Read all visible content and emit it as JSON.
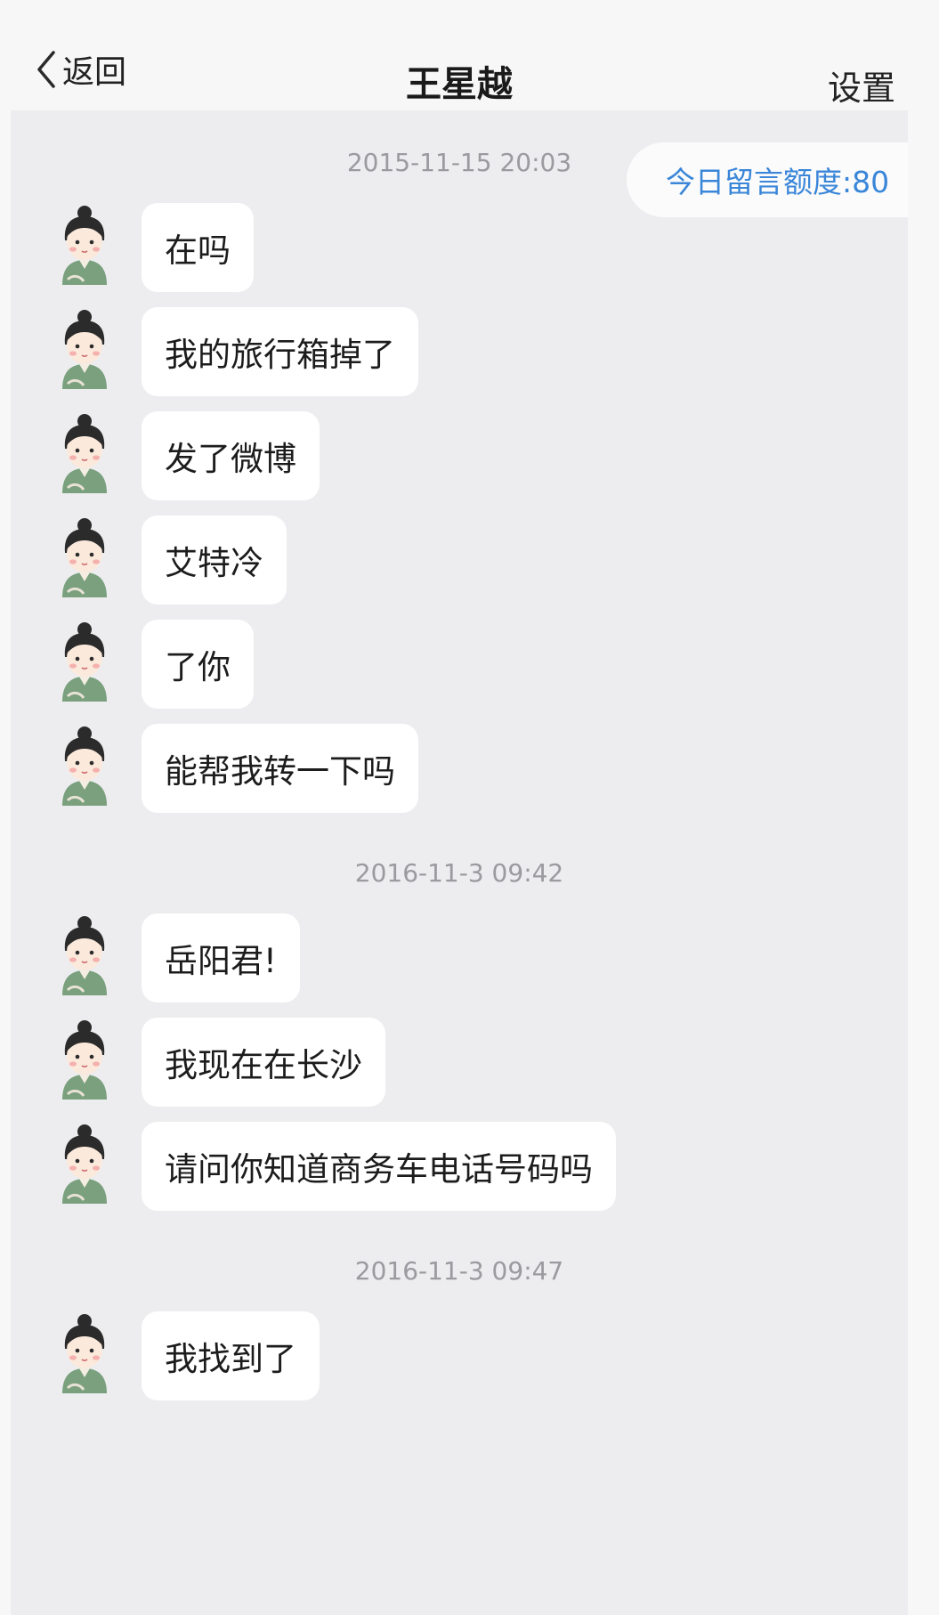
{
  "header": {
    "back_label": "返回",
    "title": "王星越",
    "settings_label": "设置"
  },
  "quota_text": "今日留言额度:80",
  "sections": [
    {
      "timestamp": "2015-11-15 20:03",
      "messages": [
        "在吗",
        "我的旅行箱掉了",
        "发了微博",
        "艾特冷",
        "了你",
        "能帮我转一下吗"
      ]
    },
    {
      "timestamp": "2016-11-3 09:42",
      "messages": [
        "岳阳君!",
        "我现在在长沙",
        "请问你知道商务车电话号码吗"
      ]
    },
    {
      "timestamp": "2016-11-3 09:47",
      "messages": [
        "我找到了"
      ]
    }
  ],
  "colors": {
    "background": "#ededef",
    "bubble": "#ffffff",
    "quota_text": "#3a86d8",
    "timestamp": "#9a9a9f",
    "avatar_robe": "#7aa07e"
  },
  "icons": {
    "back": "chevron-left-icon",
    "avatar": "girl-cartoon-avatar"
  }
}
